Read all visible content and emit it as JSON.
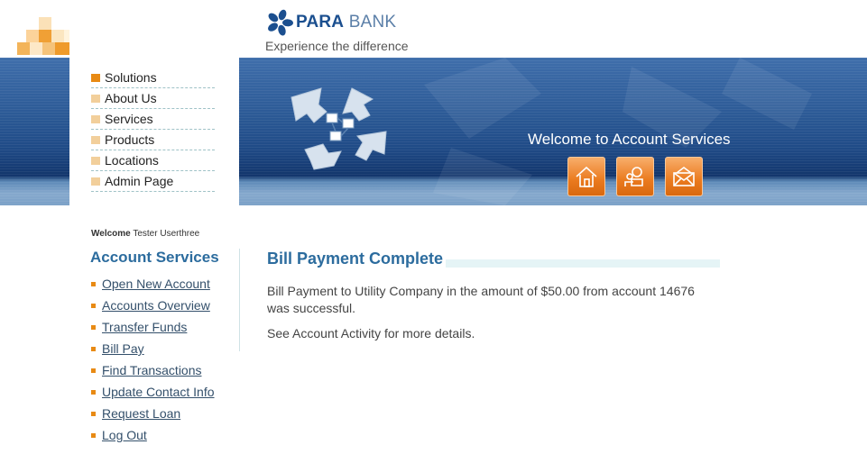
{
  "brand": {
    "name_bold": "PARA",
    "name_light": " BANK",
    "tagline": "Experience the difference"
  },
  "banner": {
    "title": "Welcome to Account Services",
    "buttons": [
      "home-icon",
      "about-icon",
      "contact-icon"
    ]
  },
  "menu": {
    "items": [
      {
        "label": "Solutions",
        "active": true
      },
      {
        "label": "About Us"
      },
      {
        "label": "Services"
      },
      {
        "label": "Products"
      },
      {
        "label": "Locations"
      },
      {
        "label": "Admin Page"
      }
    ]
  },
  "welcome": {
    "prefix": "Welcome",
    "user": " Tester Userthree"
  },
  "account_services": {
    "heading": "Account Services",
    "links": [
      "Open New Account",
      "Accounts Overview",
      "Transfer Funds",
      "Bill Pay",
      "Find Transactions",
      "Update Contact Info",
      "Request Loan",
      "Log Out"
    ]
  },
  "result": {
    "title": "Bill Payment Complete",
    "message": "Bill Payment to Utility Company in the amount of $50.00 from account 14676 was successful.",
    "note": "See Account Activity for more details."
  },
  "colors": {
    "accent": "#e88a14",
    "heading": "#2c6c9e",
    "banner": "#2c5a96"
  }
}
